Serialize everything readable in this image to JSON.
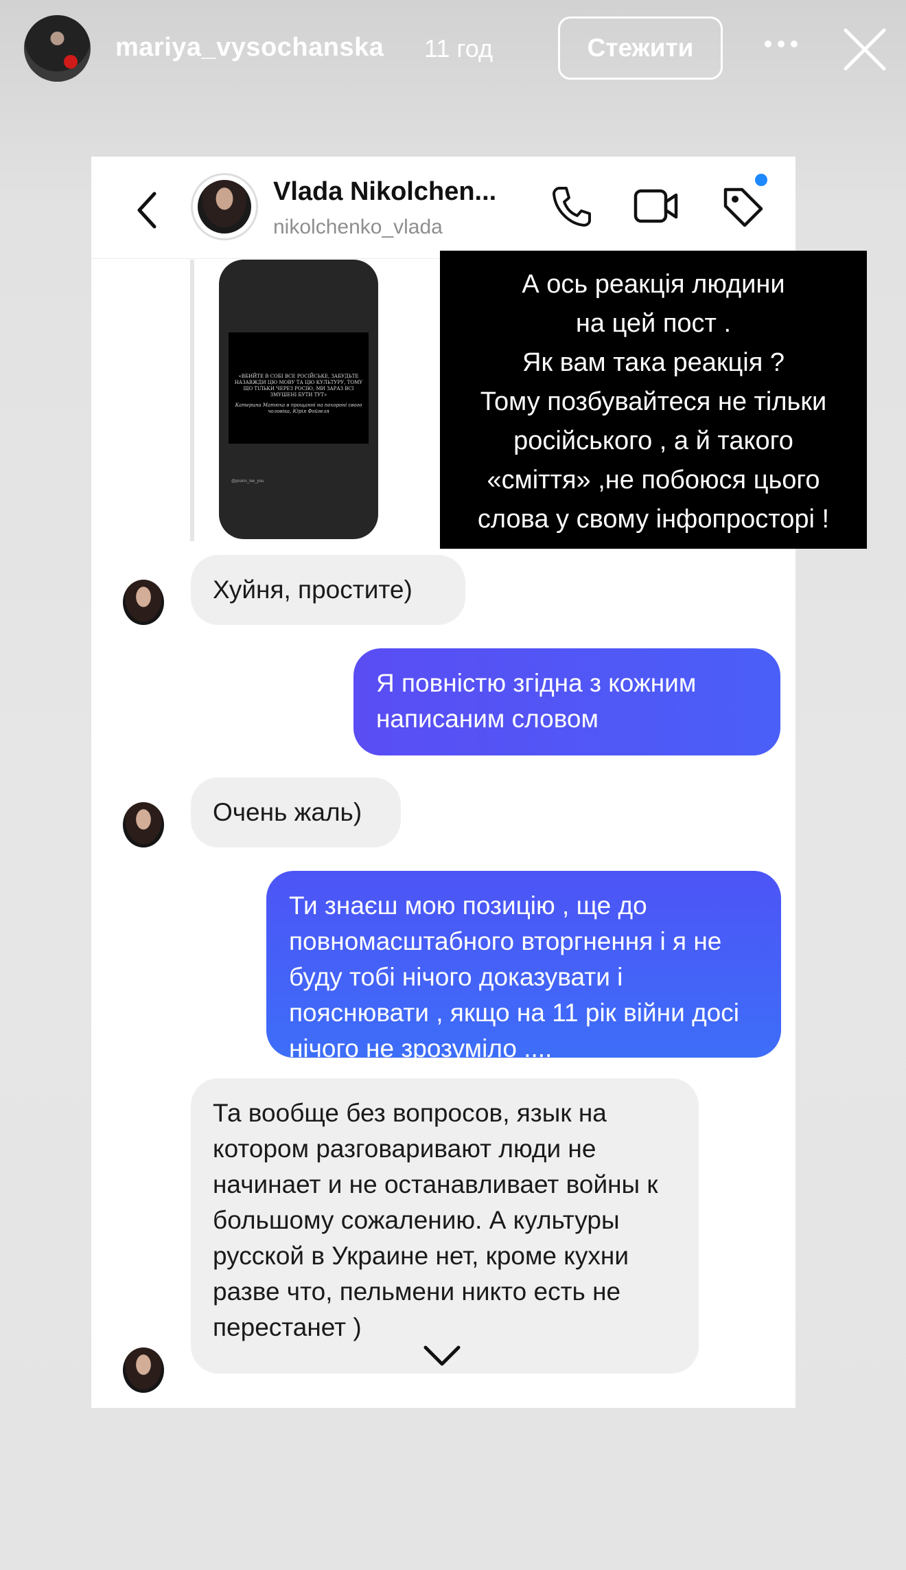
{
  "story": {
    "username": "mariya_vysochanska",
    "time_ago": "11 год",
    "follow_label": "Стежити",
    "more_icon": "more-horizontal-icon",
    "close_icon": "close-icon"
  },
  "dm": {
    "contact_name": "Vlada Nikolchen...",
    "contact_handle": "nikolchenko_vlada",
    "icons": [
      "back-icon",
      "call-icon",
      "video-call-icon",
      "tag-icon"
    ],
    "unread_dot_color": "#1e88ff",
    "shared_post": {
      "quote": "«ВБИЙТЕ В СОБІ ВСЕ РОСІЙСЬКЕ, ЗАБУДЬТЕ НАЗАВЖДИ ЦЮ МОВУ ТА ЦЮ КУЛЬТУРУ, ТОМУ ЩО ТІЛЬКИ ЧЕРЕЗ РОСІЮ, МИ ЗАРАЗ ВСІ ЗМУШЕНІ БУТИ ТУТ»",
      "quote_note": "Катерина Матюха в прощанні на похороні свого чоловіка, Юрія Фойгеля",
      "credit": "@proinn_lee_you"
    },
    "messages": [
      {
        "from": "peer",
        "text": "Хуйня, простите)"
      },
      {
        "from": "me",
        "text": "Я повністю згідна з кожним написаним словом"
      },
      {
        "from": "peer",
        "text": "Очень жаль)"
      },
      {
        "from": "me",
        "text": "Ти знаєш мою позицію , ще до повномасштабного вторгнення і я не буду тобі нічого доказувати і пояснювати , якщо на 11 рік війни досі нічого не зрозуміло ...."
      },
      {
        "from": "peer",
        "text": "Та вообще без вопросов, язык на котором разговаривают люди не начинает и не останавливает войны к большому сожалению. А культуры русской в Украине нет, кроме кухни разве что, пельмени никто есть не перестанет )"
      }
    ],
    "scroll_icon": "chevron-down-icon",
    "colors": {
      "outgoing_start": "#5a4df3",
      "outgoing_end": "#3d6ef8",
      "incoming": "#efeff0"
    }
  },
  "caption": {
    "lines": [
      "А ось реакція людини",
      "на цей пост .",
      "Як вам така реакція ?",
      "Тому позбувайтеся не тільки",
      "російського , а й такого",
      "«сміття» ,не  побоюся цього",
      "слова у свому інфопросторі !"
    ]
  }
}
